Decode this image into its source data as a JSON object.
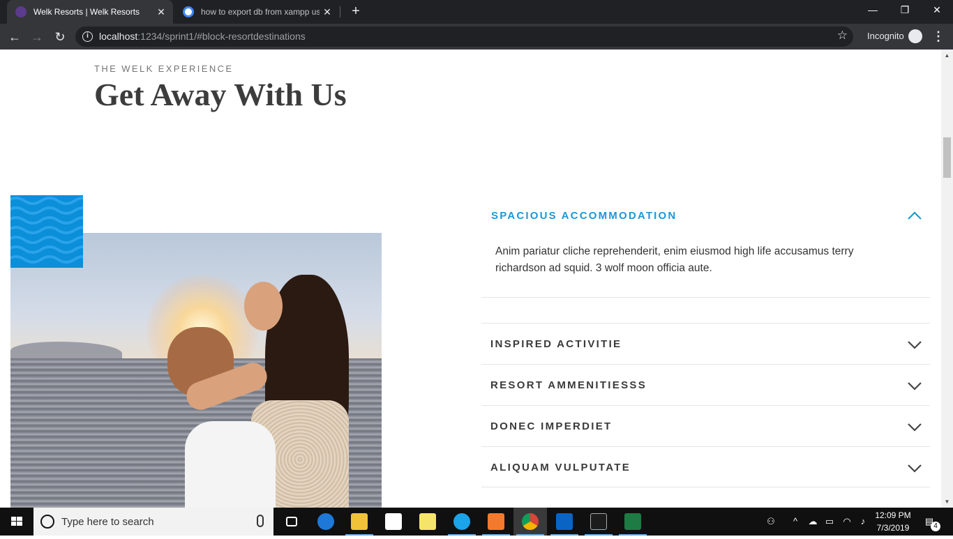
{
  "browser": {
    "tabs": [
      {
        "title": "Welk Resorts | Welk Resorts",
        "active": true
      },
      {
        "title": "how to export db from xampp us",
        "active": false
      }
    ],
    "url_host": "localhost",
    "url_path": ":1234/sprint1/#block-resortdestinations",
    "mode_label": "Incognito"
  },
  "page": {
    "eyebrow": "THE WELK EXPERIENCE",
    "headline": "Get Away With Us",
    "accordion": {
      "open_item": {
        "title": "SPACIOUS ACCOMMODATION",
        "body": "Anim pariatur cliche reprehenderit, enim eiusmod high life accusamus terry richardson ad squid. 3 wolf moon officia aute."
      },
      "items": [
        {
          "title": "INSPIRED ACTIVITIE"
        },
        {
          "title": "RESORT AMMENITIESSS"
        },
        {
          "title": "DONEC IMPERDIET"
        },
        {
          "title": "ALIQUAM VULPUTATE"
        }
      ]
    }
  },
  "taskbar": {
    "search_placeholder": "Type here to search",
    "time": "12:09 PM",
    "date": "7/3/2019",
    "notification_count": "4"
  },
  "colors": {
    "accent": "#1c97d6",
    "pattern_blue": "#0a8fd8",
    "heading": "#3c3c3c",
    "browser_dark": "#202124"
  }
}
